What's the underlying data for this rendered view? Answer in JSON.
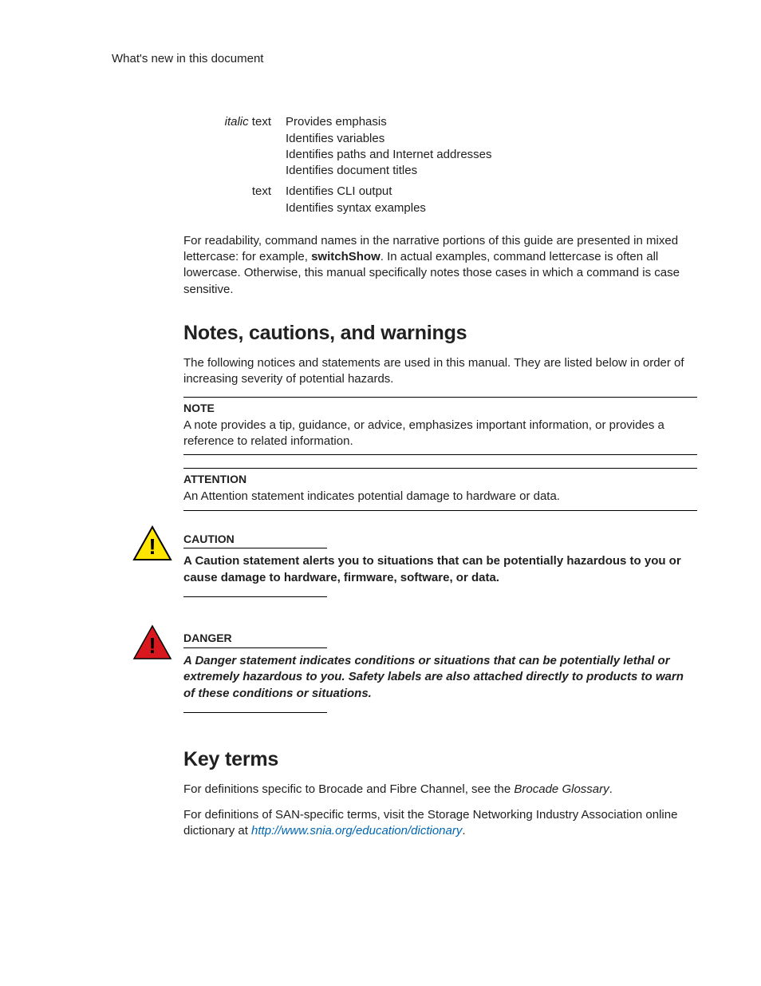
{
  "header": {
    "running_head": "What's new in this document"
  },
  "conventions": {
    "rows": [
      {
        "label_italic": "italic",
        "label_rest": " text",
        "lines": [
          "Provides emphasis",
          "Identifies variables",
          "Identifies paths and Internet addresses",
          "Identifies document titles"
        ]
      },
      {
        "label_italic": "",
        "label_rest": "text",
        "lines": [
          "Identifies CLI output",
          "Identifies syntax examples"
        ]
      }
    ],
    "readability_pre": "For readability, command names in the narrative portions of this guide are presented in mixed lettercase: for example, ",
    "readability_bold": "switchShow",
    "readability_post": ". In actual examples, command lettercase is often all lowercase. Otherwise, this manual specifically notes those cases in which a command is case sensitive."
  },
  "notes_section": {
    "heading": "Notes, cautions, and warnings",
    "intro": "The following notices and statements are used in this manual. They are listed below in order of increasing severity of potential hazards.",
    "note": {
      "title": "NOTE",
      "body": "A note provides a tip, guidance, or advice, emphasizes important information, or provides a reference to related information."
    },
    "attention": {
      "title": "ATTENTION",
      "body": "An Attention statement indicates potential damage to hardware or data."
    },
    "caution": {
      "title": "CAUTION",
      "body": "A Caution statement alerts you to situations that can be potentially hazardous to you or cause damage to hardware, firmware, software, or data."
    },
    "danger": {
      "title": "DANGER",
      "body": "A Danger statement indicates conditions or situations that can be potentially lethal or extremely hazardous to you. Safety labels are also attached directly to products to warn of these conditions or situations."
    }
  },
  "key_terms": {
    "heading": "Key terms",
    "p1_pre": "For definitions specific to Brocade and Fibre Channel, see the ",
    "p1_title": "Brocade Glossary",
    "p1_post": ".",
    "p2_pre": "For definitions of SAN-specific terms, visit the Storage Networking Industry Association online dictionary at ",
    "link_text": "http://www.snia.org/education/dictionary",
    "p2_post": "."
  }
}
